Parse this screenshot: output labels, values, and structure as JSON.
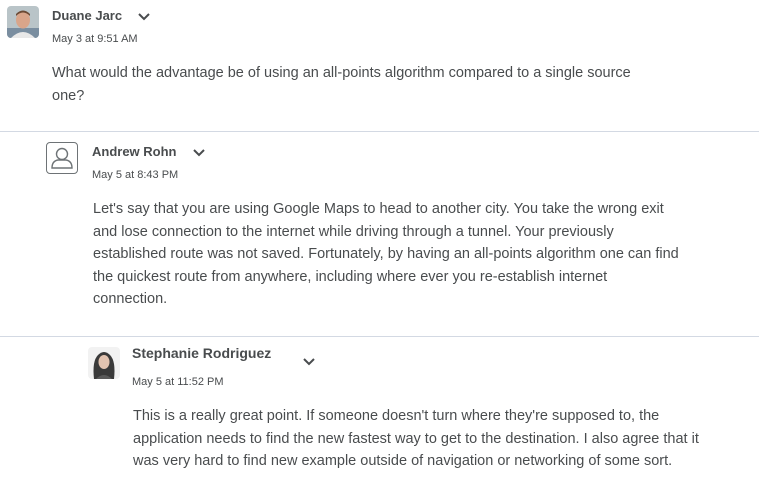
{
  "posts": [
    {
      "author": "Duane Jarc",
      "timestamp": "May 3 at 9:51 AM",
      "avatar": "user-photo",
      "lines": [
        "What would the advantage be of using an all-points algorithm compared to a single source",
        "one?"
      ]
    },
    {
      "author": "Andrew Rohn",
      "timestamp": "May 5 at 8:43 PM",
      "avatar": "default-user-icon",
      "lines": [
        "Let's say that you are using Google Maps to head to another city. You take the wrong exit",
        "and lose connection to the internet while driving through a tunnel. Your previously",
        "established route was not saved. Fortunately, by having an all-points algorithm one can find",
        "the quickest route from anywhere, including where ever you re-establish internet",
        "connection."
      ]
    },
    {
      "author": "Stephanie Rodriguez",
      "timestamp": "May 5 at 11:52 PM",
      "avatar": "user-photo",
      "lines": [
        "This is a really great point. If someone doesn't turn where they're supposed to, the",
        "application needs to find the new fastest way to get to the destination. I also agree that it",
        "was very hard to find new example outside of navigation or networking of some sort."
      ]
    }
  ],
  "icons": {
    "menu": "chevron-down-icon"
  },
  "colors": {
    "text": "#494c4e",
    "divider": "#d3d9e3"
  }
}
